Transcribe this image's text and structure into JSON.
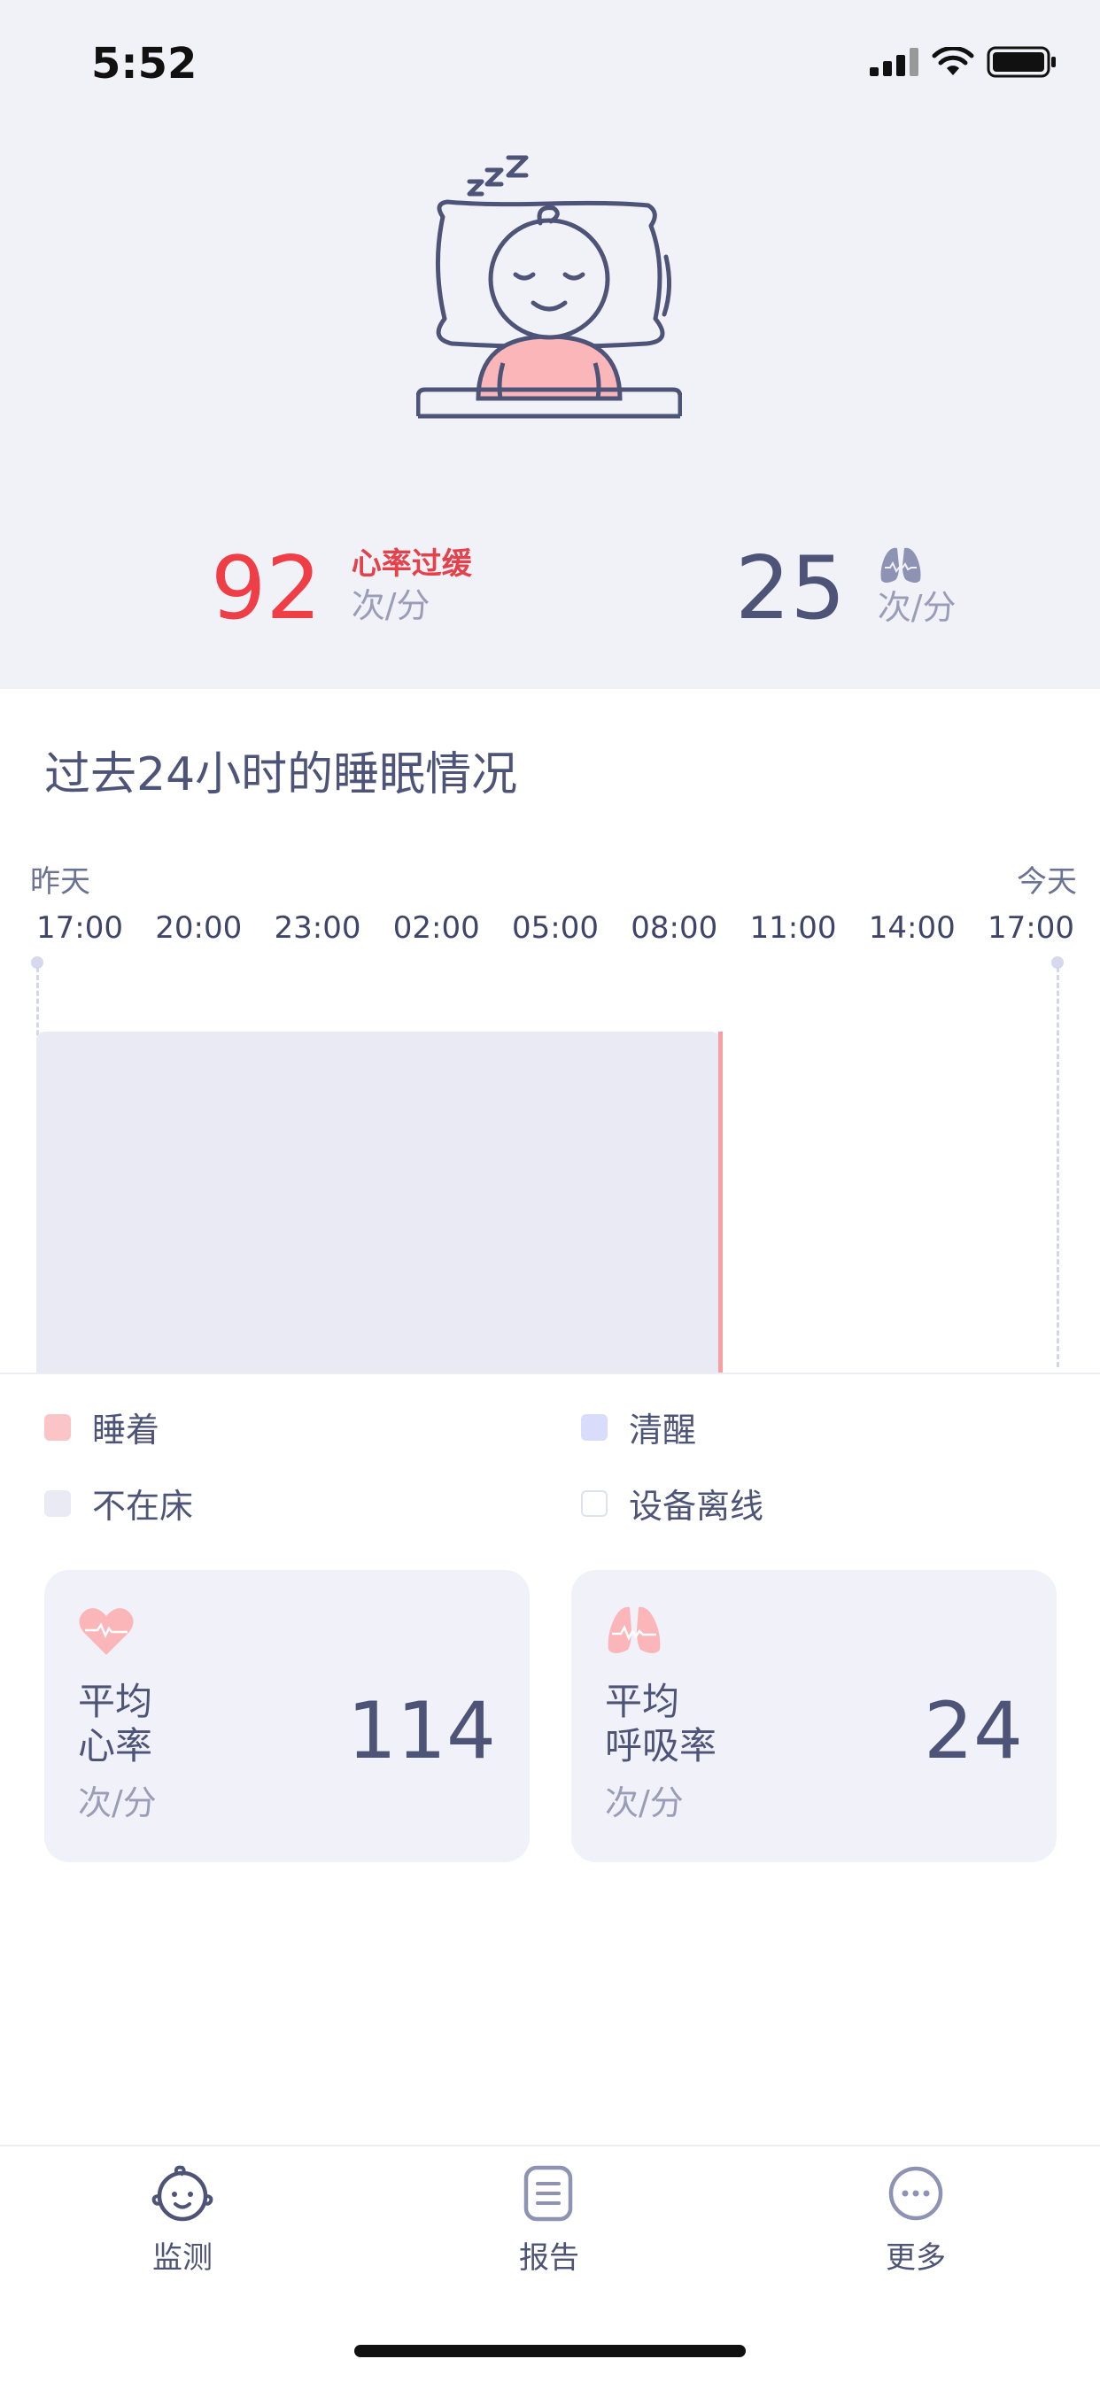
{
  "status_bar": {
    "time": "5:52"
  },
  "header": {
    "heart_rate": {
      "value": "92",
      "alert": "心率过缓",
      "unit": "次/分"
    },
    "respiration": {
      "value": "25",
      "unit": "次/分"
    }
  },
  "sleep": {
    "title": "过去24小时的睡眠情况",
    "day_start": "昨天",
    "day_end": "今天",
    "ticks": [
      "17:00",
      "20:00",
      "23:00",
      "02:00",
      "05:00",
      "08:00",
      "11:00",
      "14:00",
      "17:00"
    ]
  },
  "legend": [
    {
      "label": "睡着",
      "color": "#fbc4c7"
    },
    {
      "label": "清醒",
      "color": "#d9dcfa"
    },
    {
      "label": "不在床",
      "color": "#eaeaf5"
    },
    {
      "label": "设备离线",
      "color": "#ffffff"
    }
  ],
  "cards": {
    "heart": {
      "label1": "平均",
      "label2": "心率",
      "value": "114",
      "unit": "次/分"
    },
    "resp": {
      "label1": "平均",
      "label2": "呼吸率",
      "value": "24",
      "unit": "次/分"
    }
  },
  "tabs": [
    {
      "label": "监测",
      "icon": "baby-face-icon"
    },
    {
      "label": "报告",
      "icon": "report-icon"
    },
    {
      "label": "更多",
      "icon": "more-icon"
    }
  ],
  "colors": {
    "primary": "#4e5478",
    "alert": "#ef3e46",
    "accent_pink": "#fbb6ba",
    "background": "#f1f1f8"
  }
}
